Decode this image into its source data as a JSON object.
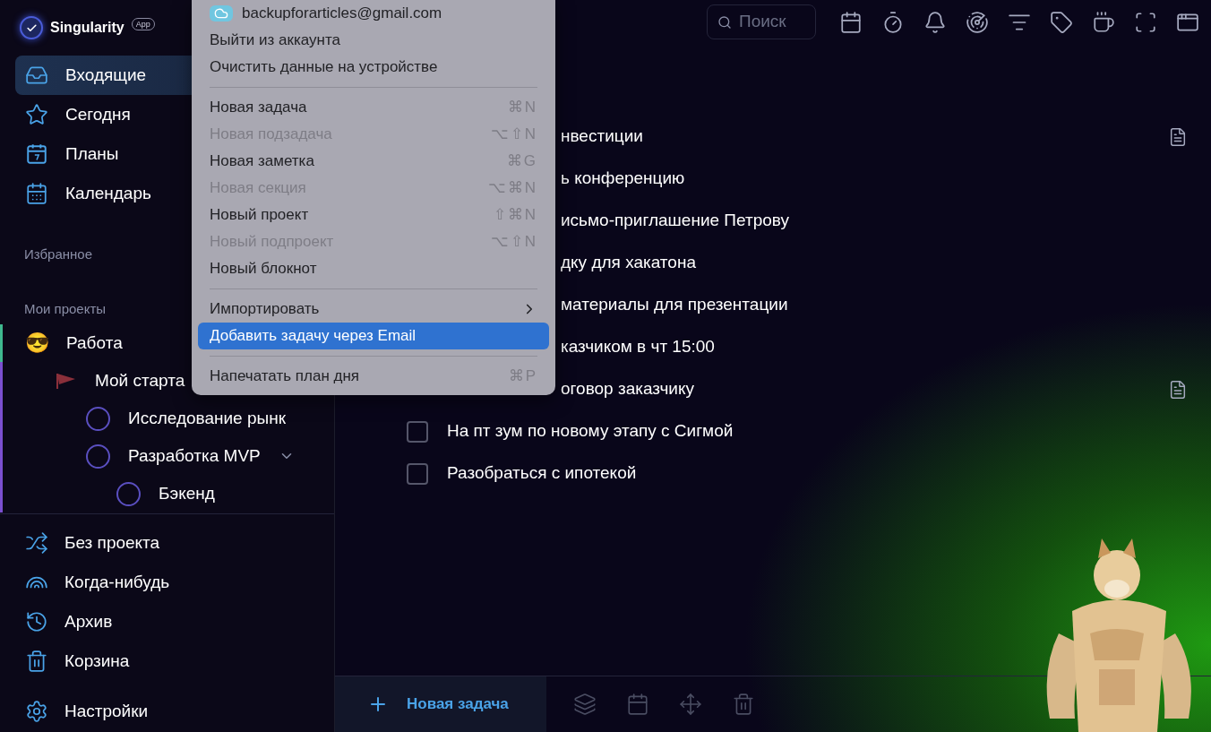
{
  "app": {
    "name": "Singularity",
    "badge": "App"
  },
  "nav": [
    {
      "label": "Входящие",
      "selected": true
    },
    {
      "label": "Сегодня",
      "selected": false
    },
    {
      "label": "Планы",
      "selected": false
    },
    {
      "label": "Календарь",
      "selected": false
    }
  ],
  "favorites_header": "Избранное",
  "projects_header": "Мои проекты",
  "projects": [
    {
      "label": "Работа",
      "emoji": "😎",
      "color": "#3fb88f",
      "children": [
        {
          "label": "Мой старта",
          "color": "#7b4fd0",
          "children": [
            {
              "label": "Исследование рынк",
              "color": "#7b4fd0"
            },
            {
              "label": "Разработка MVP",
              "color": "#7b4fd0",
              "expanded": true,
              "children": [
                {
                  "label": "Бэкенд",
                  "color": "#7b4fd0"
                }
              ]
            }
          ]
        }
      ]
    }
  ],
  "bottom_nav": [
    {
      "label": "Без проекта"
    },
    {
      "label": "Когда-нибудь"
    },
    {
      "label": "Архив"
    },
    {
      "label": "Корзина"
    }
  ],
  "settings": {
    "label": "Настройки"
  },
  "search": {
    "placeholder": "Поиск"
  },
  "tasks": [
    {
      "text": "нвестиции",
      "has_note": true
    },
    {
      "text": "ь конференцию",
      "has_note": false
    },
    {
      "text": "исьмо-приглашение Петрову",
      "has_note": false
    },
    {
      "text": "дку для хакатона",
      "has_note": false
    },
    {
      "text": "материалы для презентации",
      "has_note": false
    },
    {
      "text": "казчиком в чт 15:00",
      "has_note": false
    },
    {
      "text": "оговор заказчику",
      "has_note": true
    },
    {
      "text": "На пт зум по новому этапу с Сигмой",
      "checked": false,
      "has_note": false
    },
    {
      "text": "Разобраться с ипотекой",
      "checked": false,
      "has_note": false
    }
  ],
  "new_task_button": {
    "label": "Новая задача"
  },
  "menu": [
    {
      "kind": "account",
      "text": "backupforarticles@gmail.com"
    },
    {
      "kind": "item",
      "text": "Выйти из аккаунта",
      "disabled": false,
      "selected": false
    },
    {
      "kind": "item",
      "text": "Очистить данные на устройстве",
      "disabled": false,
      "selected": false
    },
    {
      "kind": "separator"
    },
    {
      "kind": "item",
      "text": "Новая задача",
      "shortcut": "⌘N",
      "disabled": false,
      "selected": false
    },
    {
      "kind": "item",
      "text": "Новая подзадача",
      "shortcut": "⌥⇧N",
      "disabled": true,
      "selected": false
    },
    {
      "kind": "item",
      "text": "Новая заметка",
      "shortcut": "⌘G",
      "disabled": false,
      "selected": false
    },
    {
      "kind": "item",
      "text": "Новая секция",
      "shortcut": "⌥⌘N",
      "disabled": true,
      "selected": false
    },
    {
      "kind": "item",
      "text": "Новый проект",
      "shortcut": "⇧⌘N",
      "disabled": false,
      "selected": false
    },
    {
      "kind": "item",
      "text": "Новый подпроект",
      "shortcut": "⌥⇧N",
      "disabled": true,
      "selected": false
    },
    {
      "kind": "item",
      "text": "Новый блокнот",
      "disabled": false,
      "selected": false
    },
    {
      "kind": "separator"
    },
    {
      "kind": "submenu",
      "text": "Импортировать",
      "disabled": false,
      "selected": false
    },
    {
      "kind": "item",
      "text": "Добавить задачу через Email",
      "disabled": false,
      "selected": true
    },
    {
      "kind": "separator"
    },
    {
      "kind": "item",
      "text": "Напечатать план дня",
      "shortcut": "⌘P",
      "disabled": false,
      "selected": false
    }
  ]
}
